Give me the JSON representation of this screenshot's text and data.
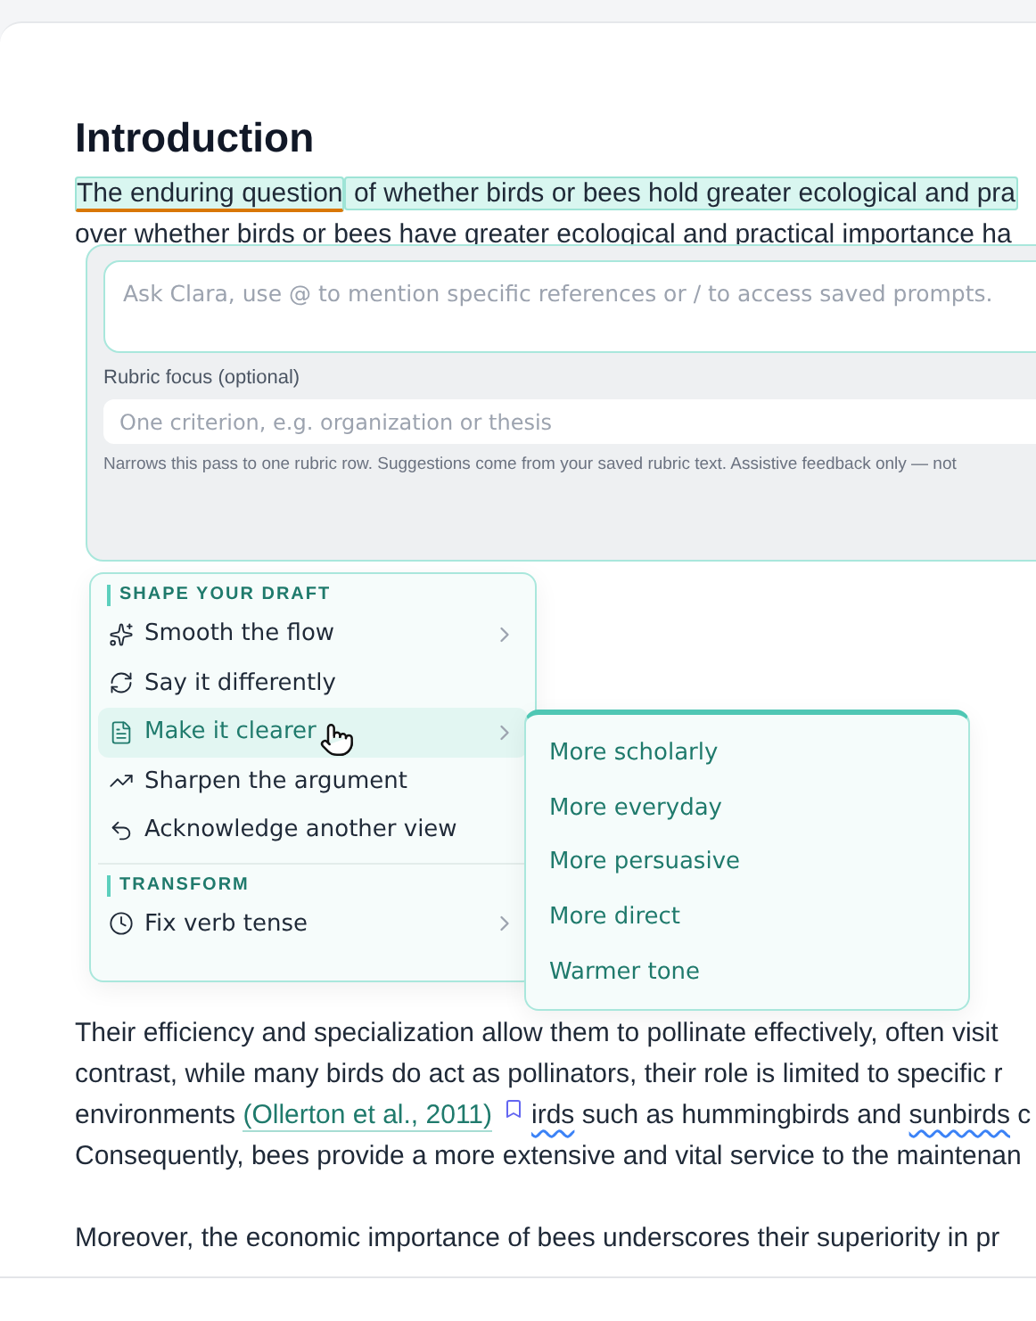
{
  "document": {
    "heading": "Introduction",
    "intro_lines": [
      {
        "runs": [
          {
            "kind": "flagged",
            "text": "The enduring question"
          },
          {
            "kind": "highlight",
            "text": " of whether birds or bees hold greater ecological and pra"
          }
        ]
      },
      {
        "runs": [
          {
            "kind": "text",
            "text": "over whether birds or bees have greater ecological and practical importance ha"
          }
        ]
      }
    ],
    "paragraphs": [
      {
        "lines": [
          {
            "runs": [
              {
                "kind": "text",
                "text": "Their efficiency and specialization allow them to pollinate effectively, often visit"
              }
            ]
          },
          {
            "runs": [
              {
                "kind": "text",
                "text": "contrast, while many birds do act as pollinators, their role is limited to specific r"
              }
            ]
          },
          {
            "runs": [
              {
                "kind": "text",
                "text": "environments "
              },
              {
                "kind": "citation",
                "text": "(Ollerton et al., 2011)"
              },
              {
                "kind": "bookmark"
              },
              {
                "kind": "misspelled",
                "text": "irds"
              },
              {
                "kind": "text",
                "text": " such as hummingbirds and "
              },
              {
                "kind": "misspelled",
                "text": "sunbirds"
              },
              {
                "kind": "text",
                "text": " c"
              }
            ]
          },
          {
            "runs": [
              {
                "kind": "text",
                "text": "Consequently, bees provide a more extensive and vital service to the maintenan"
              }
            ]
          }
        ]
      },
      {
        "lines": [
          {
            "runs": [
              {
                "kind": "text",
                "text": "Moreover, the economic importance of bees underscores their superiority in pr"
              }
            ]
          }
        ]
      }
    ]
  },
  "prompt_panel": {
    "prompt": {
      "placeholder": "Ask Clara, use @ to mention specific references or / to access saved prompts."
    },
    "rubric_label": "Rubric focus (optional)",
    "rubric": {
      "placeholder": "One criterion, e.g. organization or thesis"
    },
    "hint": "Narrows this pass to one rubric row. Suggestions come from your saved rubric text. Assistive feedback only — not"
  },
  "menu": {
    "sections": [
      {
        "title": "SHAPE YOUR DRAFT",
        "items": [
          {
            "label": "Smooth the flow",
            "submenu": true,
            "selected": false
          },
          {
            "label": "Say it differently",
            "submenu": false,
            "selected": false
          },
          {
            "label": "Make it clearer",
            "submenu": true,
            "selected": true
          },
          {
            "label": "Sharpen the argument",
            "submenu": false,
            "selected": false
          },
          {
            "label": "Acknowledge another view",
            "submenu": false,
            "selected": false
          }
        ]
      },
      {
        "title": "TRANSFORM",
        "items": [
          {
            "label": "Fix verb tense",
            "submenu": true,
            "selected": false
          }
        ]
      }
    ]
  },
  "submenu": {
    "items": [
      "More scholarly",
      "More everyday",
      "More persuasive",
      "More direct",
      "Warmer tone"
    ]
  }
}
